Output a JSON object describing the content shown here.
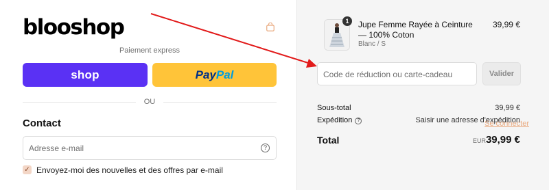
{
  "brand": {
    "logo_text": "blooshop"
  },
  "express": {
    "label": "Paiement express",
    "shop_label": "shop",
    "paypal_part1": "Pay",
    "paypal_part2": "Pal",
    "divider_label": "OU"
  },
  "contact": {
    "title": "Contact",
    "login_link": "Se connecter",
    "email_placeholder": "Adresse e-mail",
    "newsletter_label": "Envoyez-moi des nouvelles et des offres par e-mail",
    "newsletter_checked": true
  },
  "cart": {
    "item": {
      "name": "Jupe Femme Rayée à Ceinture — 100% Coton",
      "variant": "Blanc / S",
      "price": "39,99 €",
      "quantity": "1"
    },
    "discount": {
      "placeholder": "Code de réduction ou carte-cadeau",
      "button_label": "Valider"
    },
    "subtotal": {
      "label": "Sous-total",
      "value": "39,99 €"
    },
    "shipping": {
      "label": "Expédition",
      "value": "Saisir une adresse d'expédition"
    },
    "total": {
      "label": "Total",
      "currency": "EUR",
      "value": "39,99 €"
    }
  },
  "colors": {
    "shop_purple": "#5a31f4",
    "paypal_yellow": "#ffc439",
    "accent_link": "#e9a97e",
    "annotation_arrow": "#e21b1b"
  }
}
